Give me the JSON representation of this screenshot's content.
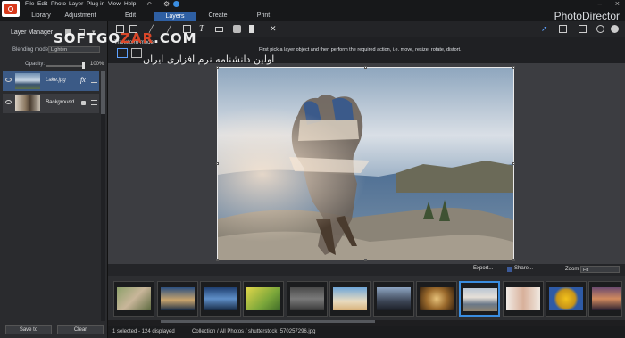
{
  "menu": {
    "items": [
      "File",
      "Edit",
      "Photo",
      "Layer",
      "Plug-in",
      "View",
      "Help"
    ],
    "app_title": "PhotoDirector",
    "minimize": "–",
    "close": "×"
  },
  "tabs": [
    "Library",
    "Adjustment",
    "Edit",
    "Layers",
    "Create",
    "Print"
  ],
  "active_tab": "Layers",
  "layer_manager": {
    "title": "Layer Manager",
    "blending_label": "Blending mode:",
    "blending_value": "Lighten",
    "opacity_label": "Opacity:",
    "opacity_value": "100%",
    "opacity_level": 1.0,
    "layers": [
      {
        "name": "Lake.jpg",
        "fx": "fx"
      },
      {
        "name": "Background"
      }
    ]
  },
  "transform": {
    "label": "Transform mode",
    "instruction": "First pick a layer object and then perform the required action, i.e. move, resize, rotate, distort."
  },
  "browser": {
    "export": "Export...",
    "share": "Share...",
    "zoom_label": "Zoom",
    "zoom_value": "Fit"
  },
  "status": {
    "selection": "1 selected - 124 displayed",
    "path": "Collection / All Photos / shutterstock_570257296.jpg"
  },
  "buttons": {
    "save": "Save to",
    "clear": "Clear"
  },
  "watermark": {
    "line1_a": "SOFTGO",
    "line1_b": "ZAR",
    "line1_c": ".COM",
    "line2": "اولین دانشنامه نرم افزاری ایران"
  },
  "colors": {
    "accent": "#3a8de0",
    "active_tab": "#2e5fa3",
    "selected_layer": "#3b5a86"
  }
}
